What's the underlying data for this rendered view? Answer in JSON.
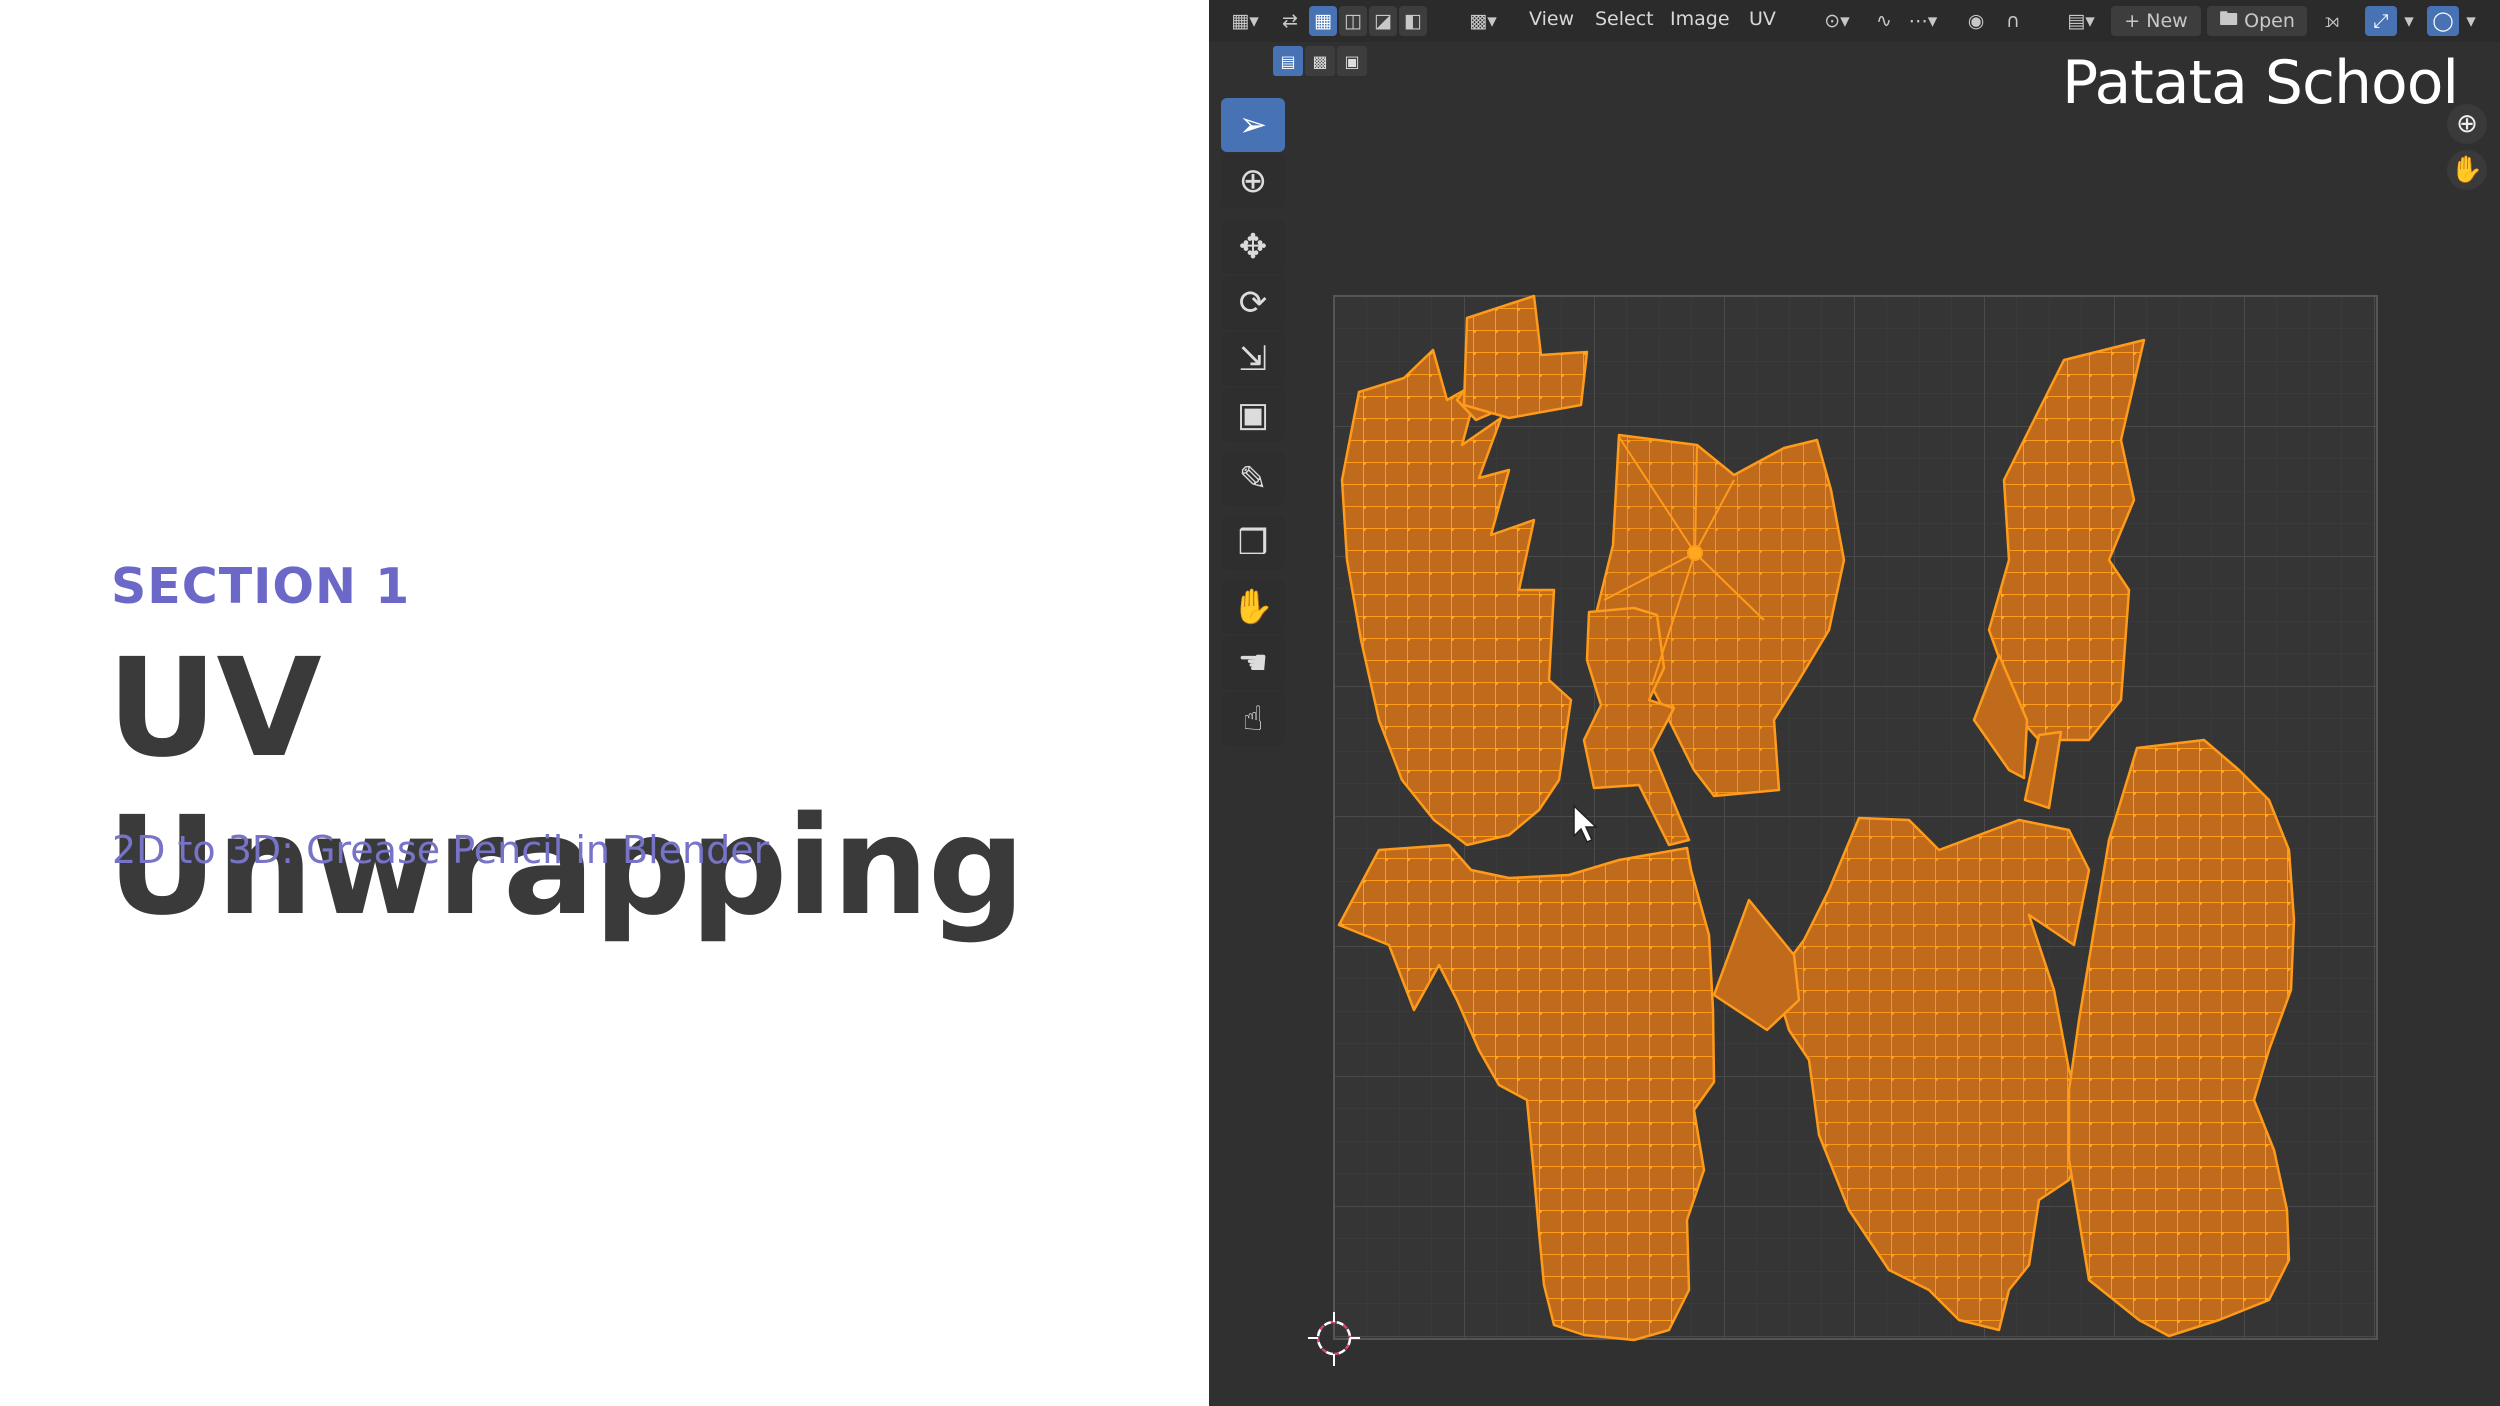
{
  "slide": {
    "section": "SECTION 1",
    "title": "UV Unwrapping",
    "subtitle": "2D to 3D: Grease Pencil in Blender"
  },
  "editor": {
    "menus": [
      "View",
      "Select",
      "Image",
      "UV"
    ],
    "new_label": "New",
    "open_label": "Open",
    "watermark": "Patata School"
  },
  "colors": {
    "island_fill": "#c06a1c",
    "island_edge": "#ff9b1a",
    "grid_bg": "#3a3a3a",
    "active_blue": "#4772b3",
    "accent_purple": "#6c68c8"
  },
  "icons": {
    "toolbar": [
      "select-box-icon",
      "cursor-icon",
      "move-icon",
      "rotate-icon",
      "scale-icon",
      "transform-icon",
      "annotate-icon",
      "rip-region-icon",
      "grab-icon",
      "relax-icon",
      "pinch-icon"
    ],
    "header": [
      "editor-type-icon",
      "sync-selection-icon",
      "vertex-select-icon",
      "edge-select-icon",
      "face-select-icon",
      "island-select-icon",
      "sticky-select-icon",
      "pivot-icon",
      "snap-icon",
      "proportional-icon",
      "image-browse-icon",
      "pin-icon",
      "gizmo-icon",
      "overlay-icon"
    ]
  }
}
